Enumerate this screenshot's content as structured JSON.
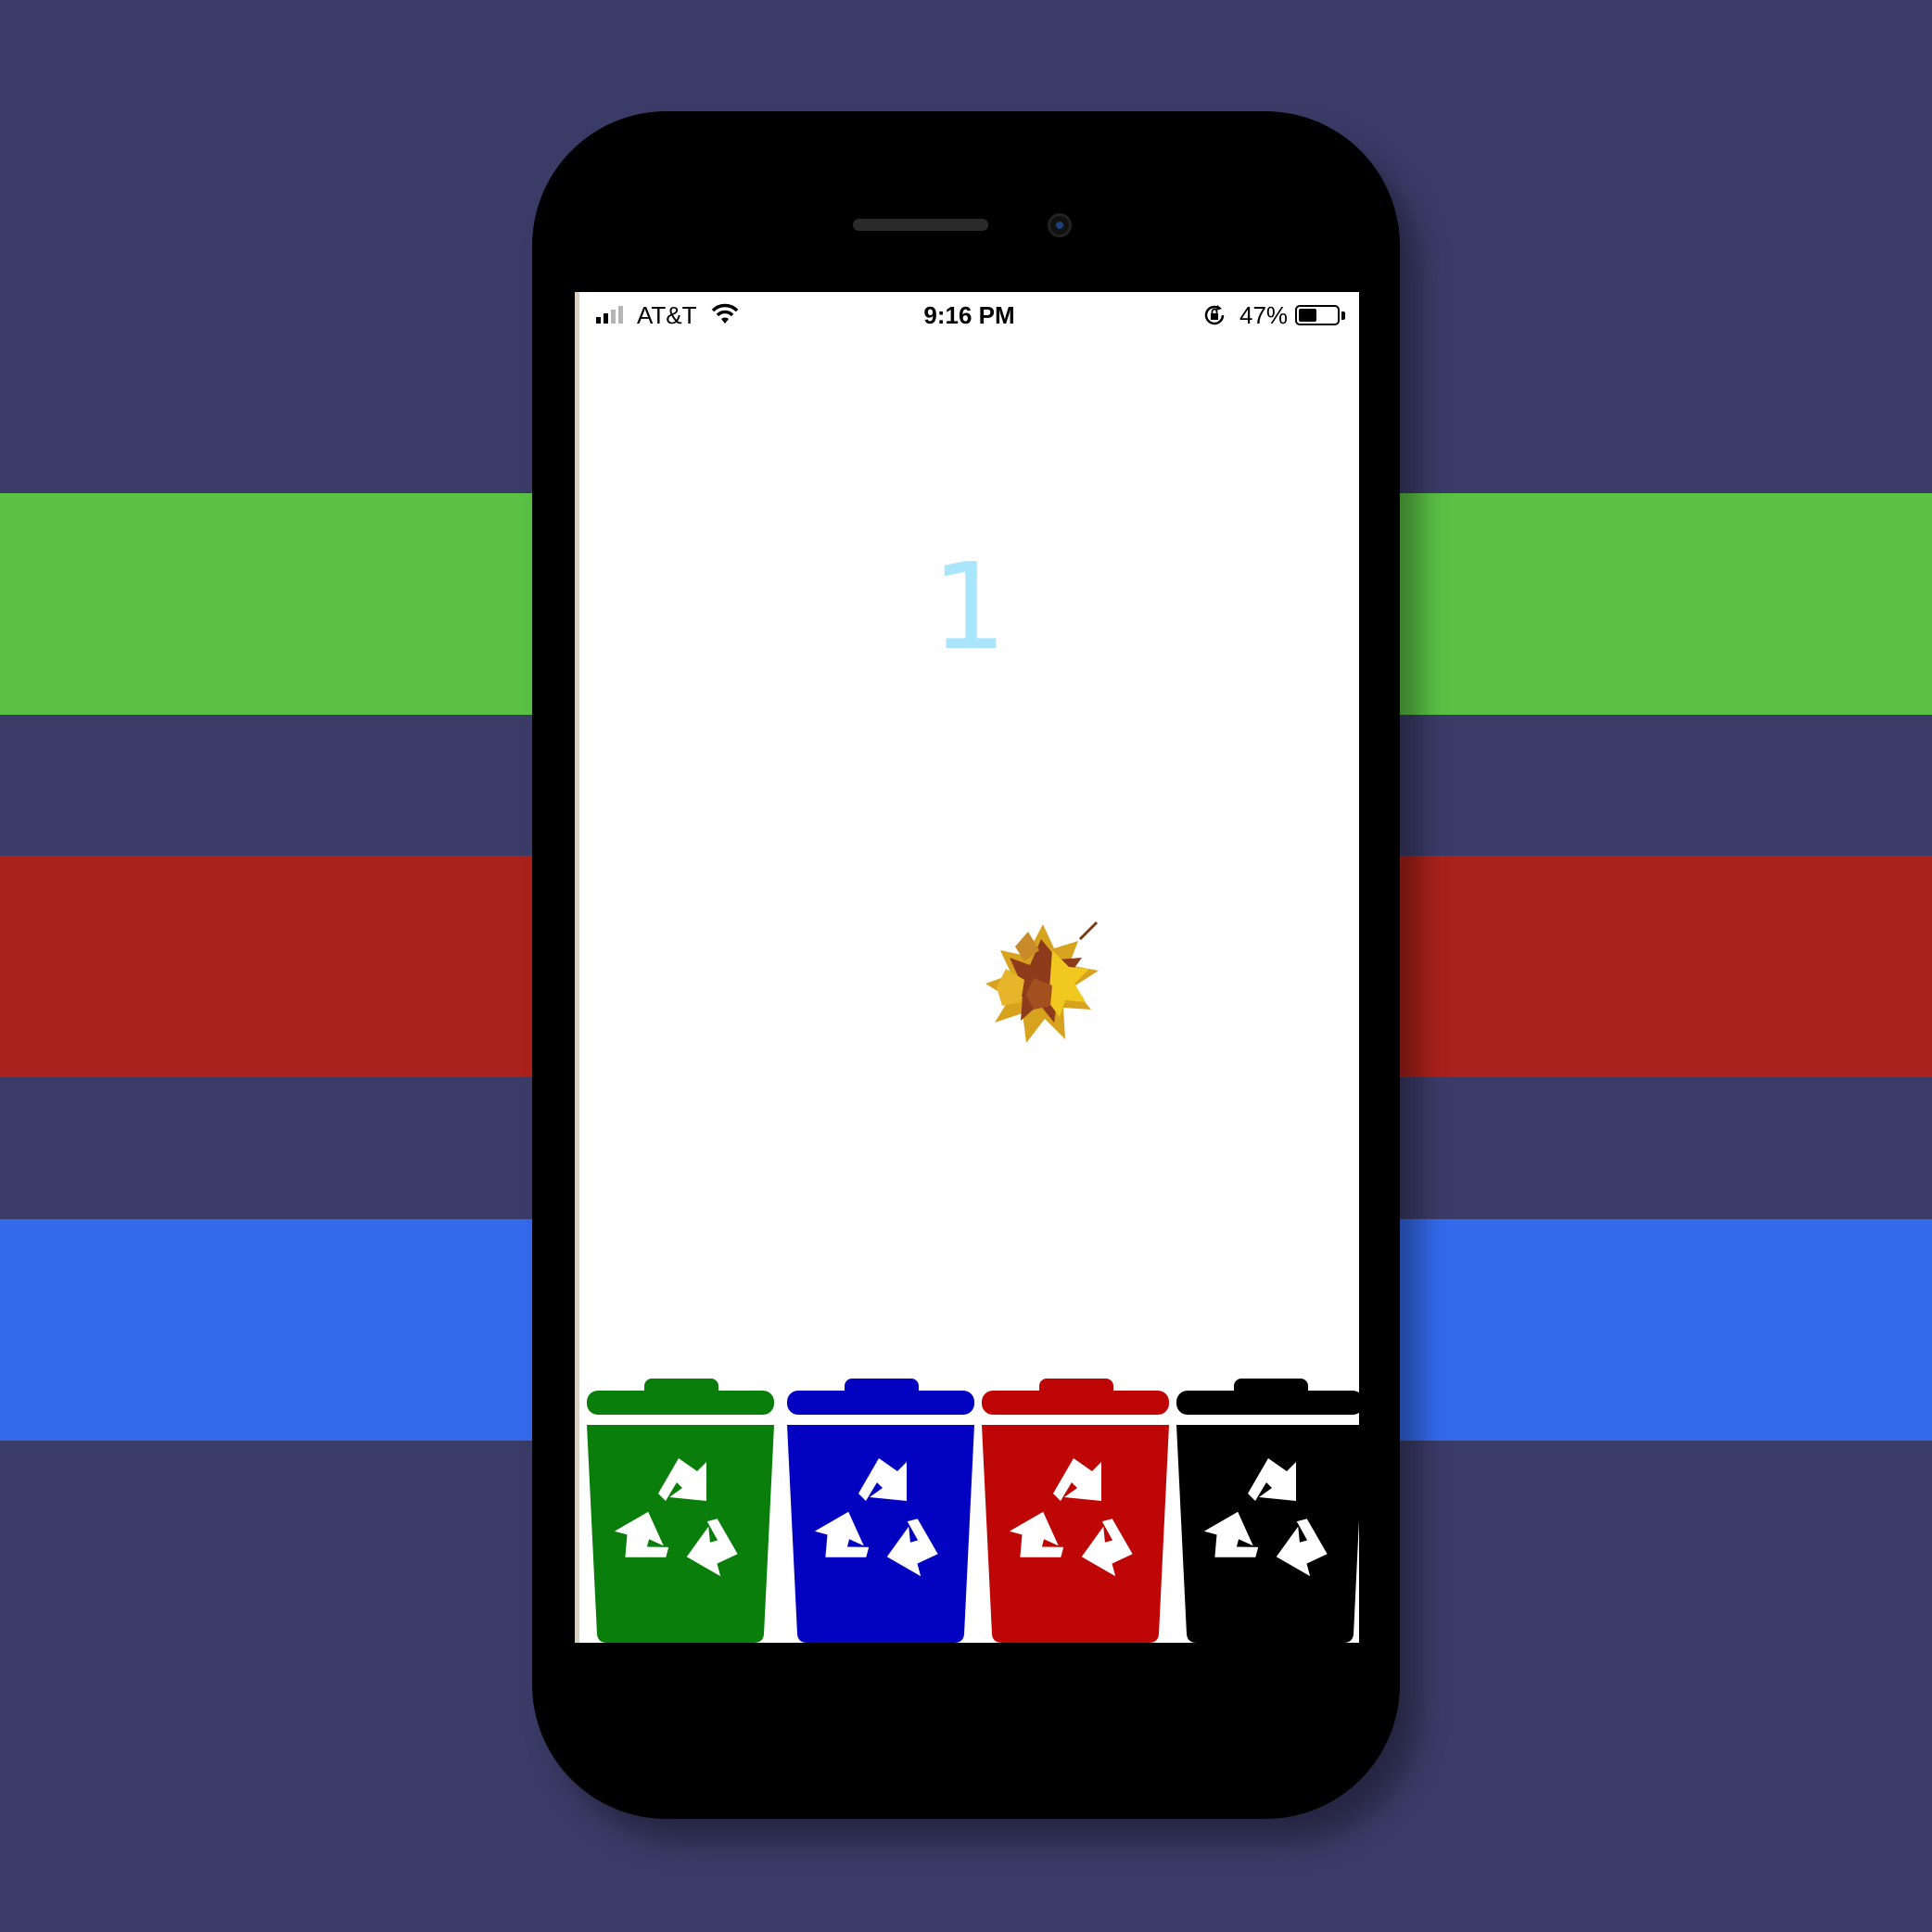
{
  "status_bar": {
    "carrier": "AT&T",
    "time": "9:16 PM",
    "battery_percent": "47%",
    "battery_level": 0.47,
    "signal_bars_filled": 2,
    "signal_bars_total": 4
  },
  "game": {
    "score": "1",
    "falling_item": "leaves-icon",
    "bins": [
      {
        "color": "#0a7e0a",
        "icon": "recycle-icon"
      },
      {
        "color": "#0202c0",
        "icon": "recycle-icon"
      },
      {
        "color": "#bf0606",
        "icon": "recycle-icon"
      },
      {
        "color": "#000000",
        "icon": "recycle-icon"
      }
    ]
  },
  "background": {
    "base_color": "#3b3b68",
    "stripe_colors": [
      "#5ac145",
      "#ab211b",
      "#336aeb"
    ]
  }
}
